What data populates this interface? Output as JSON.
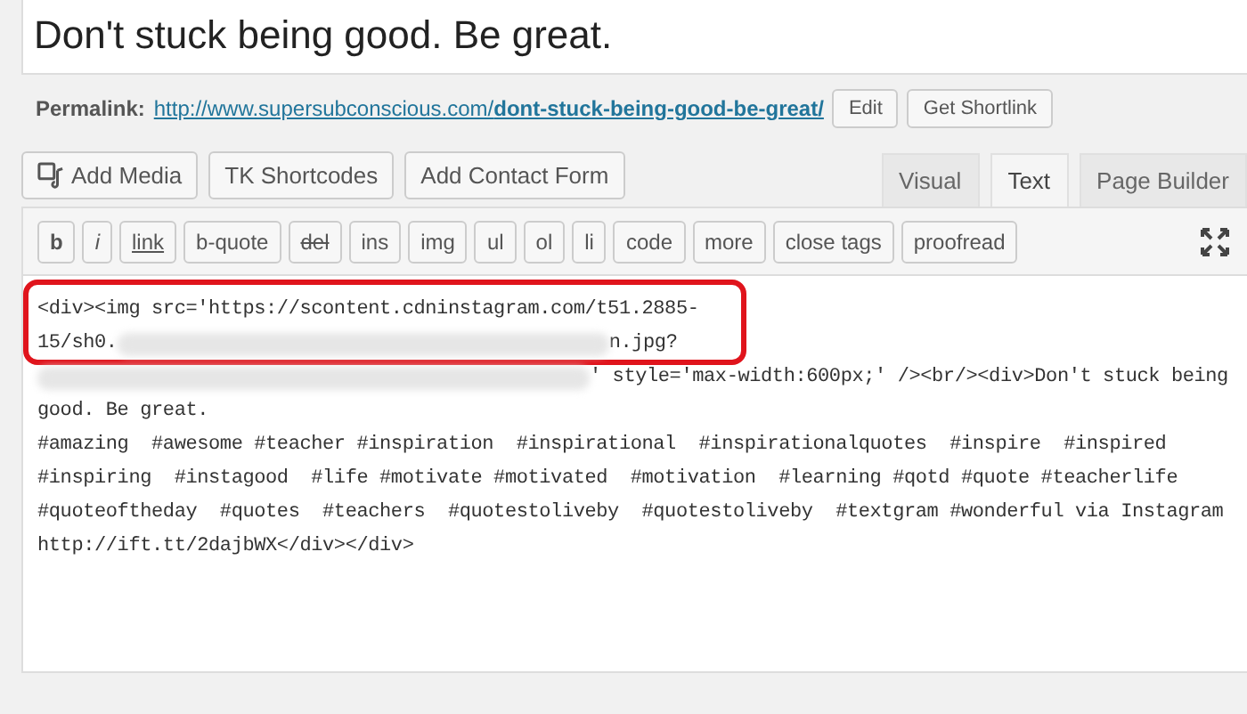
{
  "title": "Don't stuck being good. Be great.",
  "permalink": {
    "label": "Permalink:",
    "base": "http://www.supersubconscious.com/",
    "slug": "dont-stuck-being-good-be-great/",
    "buttons": [
      "Edit",
      "Get Shortlink"
    ]
  },
  "media_buttons": [
    {
      "label": "Add Media",
      "kind": "media"
    },
    {
      "label": "TK Shortcodes",
      "kind": "plain"
    },
    {
      "label": "Add Contact Form",
      "kind": "plain"
    }
  ],
  "tabs": [
    {
      "label": "Visual",
      "selected": false
    },
    {
      "label": "Text",
      "selected": true
    },
    {
      "label": "Page Builder",
      "selected": false
    }
  ],
  "quicktags": [
    {
      "label": "b",
      "kind": "bold"
    },
    {
      "label": "i",
      "kind": "italic"
    },
    {
      "label": "link",
      "kind": "link"
    },
    {
      "label": "b-quote",
      "kind": "plain"
    },
    {
      "label": "del",
      "kind": "strike"
    },
    {
      "label": "ins",
      "kind": "plain"
    },
    {
      "label": "img",
      "kind": "plain"
    },
    {
      "label": "ul",
      "kind": "plain"
    },
    {
      "label": "ol",
      "kind": "plain"
    },
    {
      "label": "li",
      "kind": "plain"
    },
    {
      "label": "code",
      "kind": "plain"
    },
    {
      "label": "more",
      "kind": "plain"
    },
    {
      "label": "close tags",
      "kind": "plain"
    },
    {
      "label": "proofread",
      "kind": "plain"
    }
  ],
  "code_lines": [
    {
      "parts": [
        {
          "kind": "text",
          "text": "<div><img src='https://scontent.cdninstagram.com/t51.2885-"
        }
      ]
    },
    {
      "parts": [
        {
          "kind": "text",
          "text": "15/sh0."
        },
        {
          "kind": "blurred"
        },
        {
          "kind": "text",
          "text": "n.jpg?"
        }
      ]
    },
    {
      "parts": [
        {
          "kind": "covered"
        },
        {
          "kind": "text",
          "text": "' style='max-width:600px;' /><br/><div>Don't stuck being"
        }
      ]
    },
    {
      "parts": [
        {
          "kind": "text",
          "text": "good. Be great."
        }
      ]
    },
    {
      "parts": [
        {
          "kind": "text",
          "text": "#amazing  #awesome #teacher #inspiration  #inspirational  #inspirationalquotes  #inspire  #inspired"
        }
      ]
    },
    {
      "parts": [
        {
          "kind": "text",
          "text": "#inspiring  #instagood  #life #motivate #motivated  #motivation  #learning #qotd #quote #teacherlife"
        }
      ]
    },
    {
      "parts": [
        {
          "kind": "text",
          "text": "#quoteoftheday  #quotes  #teachers  #quotestoliveby  #quotestoliveby  #textgram #wonderful via Instagram"
        }
      ]
    },
    {
      "parts": [
        {
          "kind": "text",
          "text": "http://ift.tt/2dajbWX</div></div>"
        }
      ]
    }
  ]
}
